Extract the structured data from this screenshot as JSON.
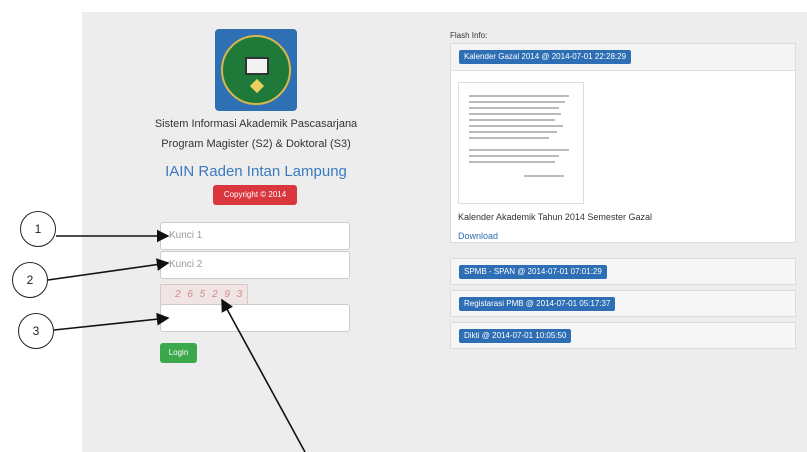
{
  "login": {
    "system_line1": "Sistem Informasi Akademik Pascasarjana",
    "system_line2": "Program Magister (S2) & Doktoral (S3)",
    "institution": "IAIN Raden Intan Lampung",
    "copyright": "Copyright © 2014",
    "inputs": {
      "kunci1_placeholder": "Kunci 1",
      "kunci2_placeholder": "Kunci 2",
      "captcha_placeholder": ""
    },
    "captcha_text": "2 6 5 2 9 3",
    "login_button": "Login"
  },
  "flash": {
    "title": "Flash Info:",
    "items": [
      {
        "badge": "Kalender Gazal 2014 @ 2014-07-01 22:28:29"
      },
      {
        "badge": "SPMB - SPAN @ 2014-07-01 07:01:29"
      },
      {
        "badge": "Registarasi PMB @ 2014-07-01 05:17:37"
      },
      {
        "badge": "Dikti @ 2014-07-01 10:05:50"
      }
    ],
    "expanded": {
      "description": "Kalender Akademik Tahun 2014 Semester Gazal",
      "download": "Download"
    }
  },
  "annotations": [
    "1",
    "2",
    "3"
  ],
  "colors": {
    "badge_blue": "#2d6eb5",
    "login_green": "#3aa84b",
    "copyright_red": "#d9363e",
    "institution_blue": "#3a7bbf"
  },
  "icons": [
    "institution-logo-icon"
  ]
}
